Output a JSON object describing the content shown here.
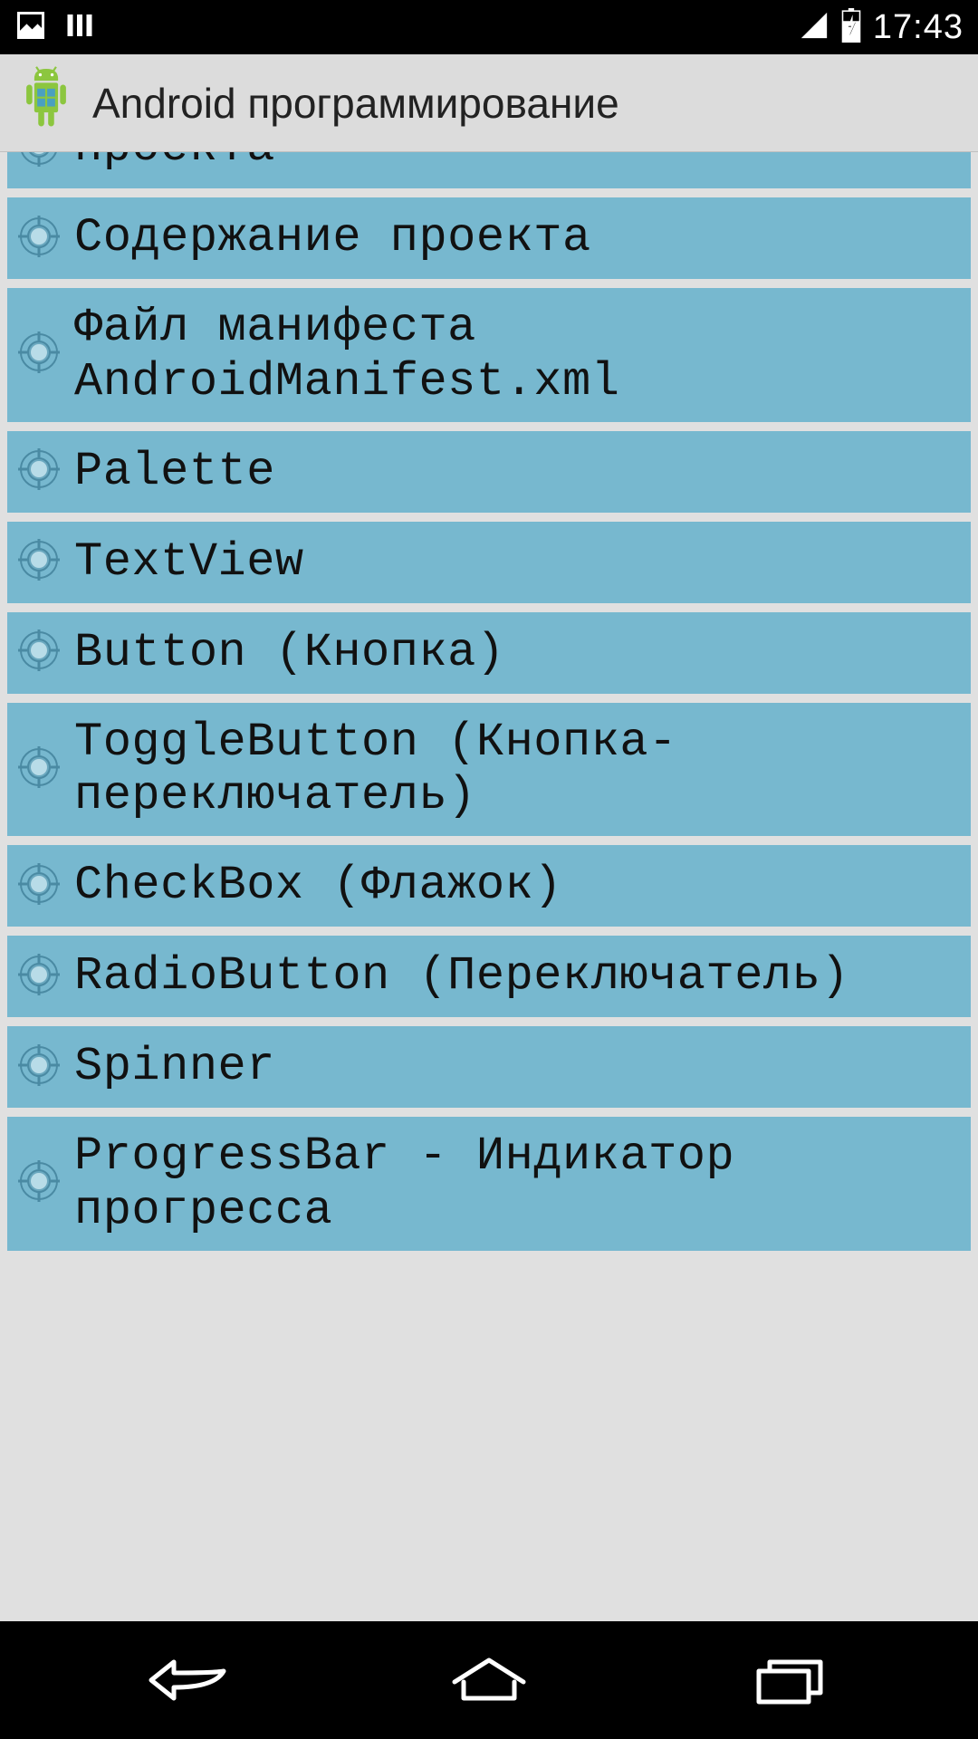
{
  "status": {
    "time": "17:43"
  },
  "app": {
    "title": "Android программирование"
  },
  "list": {
    "items": [
      {
        "label": "проекта"
      },
      {
        "label": "Содержание проекта"
      },
      {
        "label": "Файл манифеста AndroidManifest.xml"
      },
      {
        "label": "Palette"
      },
      {
        "label": "TextView"
      },
      {
        "label": "Button (Кнопка)"
      },
      {
        "label": "ToggleButton (Кнопка-переключатель)"
      },
      {
        "label": "CheckBox (Флажок)"
      },
      {
        "label": "RadioButton (Переключатель)"
      },
      {
        "label": "Spinner"
      },
      {
        "label": "ProgressBar - Индикатор прогресса"
      }
    ]
  },
  "icons": {
    "bullet": "reticle-icon",
    "android": "android-icon"
  }
}
